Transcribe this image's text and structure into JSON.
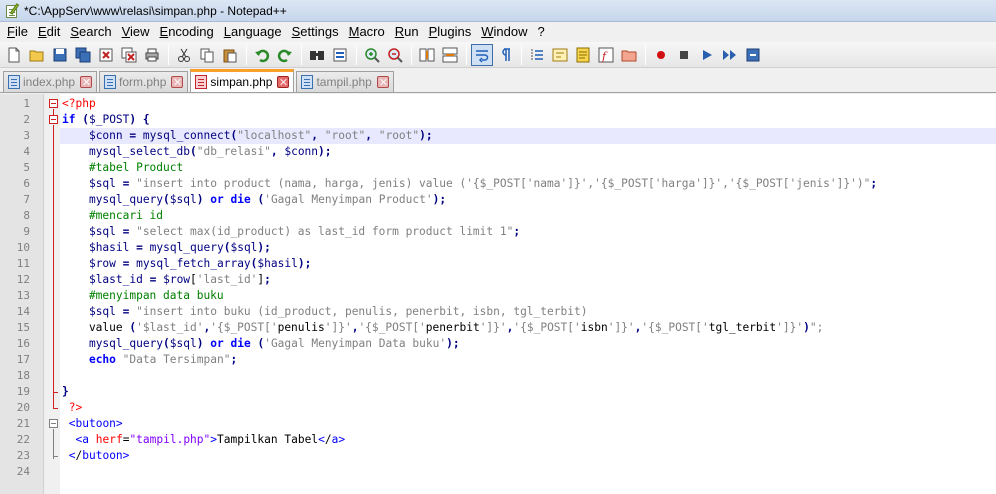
{
  "window": {
    "title": "*C:\\AppServ\\www\\relasi\\simpan.php - Notepad++"
  },
  "menu": {
    "items": [
      "File",
      "Edit",
      "Search",
      "View",
      "Encoding",
      "Language",
      "Settings",
      "Macro",
      "Run",
      "Plugins",
      "Window",
      "?"
    ]
  },
  "toolbar": {
    "buttons": [
      "new-file-icon",
      "open-file-icon",
      "save-icon",
      "save-all-icon",
      "close-icon",
      "close-all-icon",
      "print-icon",
      "cut-icon",
      "copy-icon",
      "paste-icon",
      "undo-icon",
      "redo-icon",
      "find-icon",
      "replace-icon",
      "zoom-in-icon",
      "zoom-out-icon",
      "sync-vertical-icon",
      "sync-horizontal-icon",
      "word-wrap-icon",
      "show-all-chars-icon",
      "indent-guide-icon",
      "user-language-icon",
      "doc-map-icon",
      "function-list-icon",
      "folder-workspace-icon",
      "record-macro-icon",
      "stop-record-icon",
      "play-macro-icon",
      "run-macro-multiple-icon",
      "save-macro-icon"
    ]
  },
  "tabs": [
    {
      "label": "index.php",
      "state": "saved",
      "active": false
    },
    {
      "label": "form.php",
      "state": "saved",
      "active": false
    },
    {
      "label": "simpan.php",
      "state": "unsaved",
      "active": true
    },
    {
      "label": "tampil.php",
      "state": "saved",
      "active": false
    }
  ],
  "editor": {
    "current_line": 3,
    "colors": {
      "keyword": "#0000ff",
      "string": "#808080",
      "variable": "#000080",
      "function": "#000080",
      "comment": "#008000",
      "tag": "#0000ff",
      "php_tag": "#ff0000",
      "html_attr": "#ff0000",
      "html_value": "#8000ff"
    },
    "lines": [
      {
        "num": "1",
        "text": "<?php"
      },
      {
        "num": "2",
        "text": "if ($_POST) {"
      },
      {
        "num": "3",
        "text": "    $conn = mysql_connect(\"localhost\", \"root\", \"root\");"
      },
      {
        "num": "4",
        "text": "    mysql_select_db(\"db_relasi\", $conn);"
      },
      {
        "num": "5",
        "text": "    #tabel Product"
      },
      {
        "num": "6",
        "text": "    $sql = \"insert into product (nama, harga, jenis) value ('{$_POST['nama']}','{$_POST['harga']}','{$_POST['jenis']}')\";"
      },
      {
        "num": "7",
        "text": "    mysql_query($sql) or die ('Gagal Menyimpan Product');"
      },
      {
        "num": "8",
        "text": "    #mencari id"
      },
      {
        "num": "9",
        "text": "    $sql = \"select max(id_product) as last_id form product limit 1\";"
      },
      {
        "num": "10",
        "text": "    $hasil = mysql_query($sql);"
      },
      {
        "num": "11",
        "text": "    $row = mysql_fetch_array($hasil);"
      },
      {
        "num": "12",
        "text": "    $last_id = $row['last_id'];"
      },
      {
        "num": "13",
        "text": "    #menyimpan data buku"
      },
      {
        "num": "14",
        "text": "    $sql = \"insert into buku (id_product, penulis, penerbit, isbn, tgl_terbit)"
      },
      {
        "num": "15",
        "text": "    value ('$last_id','{$_POST['penulis']}','{$_POST['penerbit']}','{$_POST['isbn']}','{$_POST['tgl_terbit']}')\";"
      },
      {
        "num": "16",
        "text": "    mysql_query($sql) or die ('Gagal Menyimpan Data buku');"
      },
      {
        "num": "17",
        "text": "    echo \"Data Tersimpan\";"
      },
      {
        "num": "18",
        "text": ""
      },
      {
        "num": "19",
        "text": "}"
      },
      {
        "num": "20",
        "text": " ?>"
      },
      {
        "num": "21",
        "text": " <butoon>"
      },
      {
        "num": "22",
        "text": "  <a herf=\"tampil.php\">Tampilkan Tabel</a>"
      },
      {
        "num": "23",
        "text": " </butoon>"
      },
      {
        "num": "24",
        "text": ""
      }
    ]
  }
}
